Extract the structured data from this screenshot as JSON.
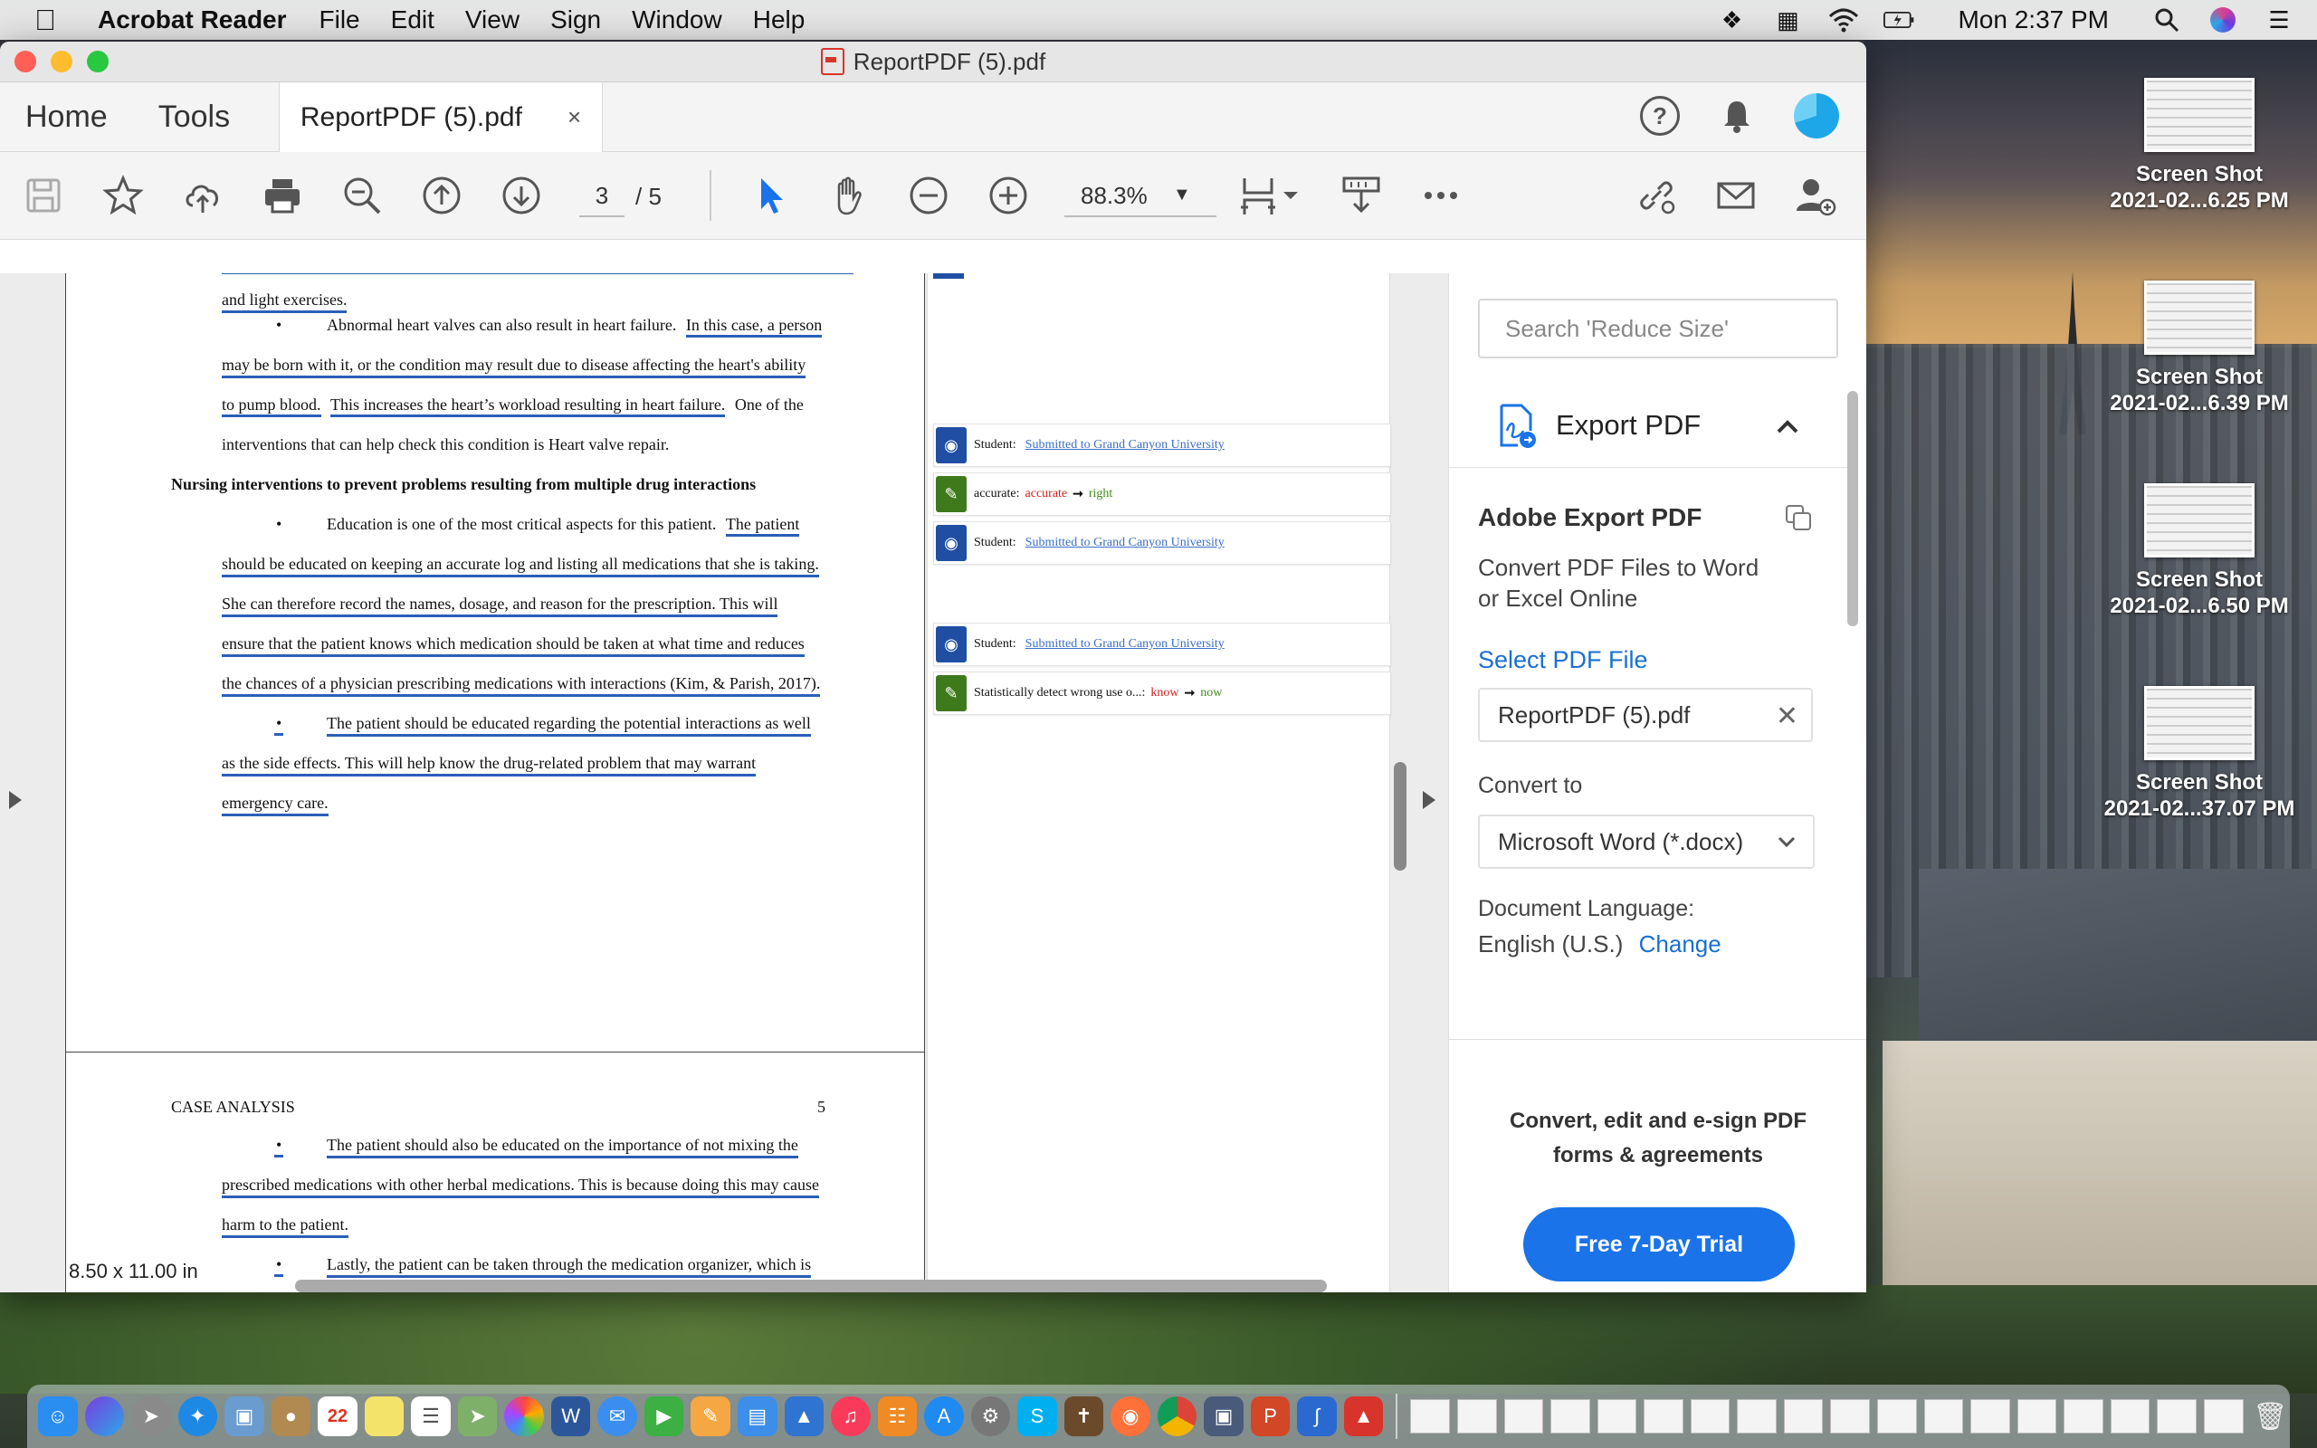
{
  "menubar": {
    "app_name": "Acrobat Reader",
    "items": [
      "File",
      "Edit",
      "View",
      "Sign",
      "Window",
      "Help"
    ],
    "clock": "Mon 2:37 PM"
  },
  "window": {
    "title": "ReportPDF (5).pdf"
  },
  "tabs": {
    "home": "Home",
    "tools": "Tools",
    "document": "ReportPDF (5).pdf",
    "close": "×"
  },
  "toolbar": {
    "current_page": "3",
    "total_pages": "/ 5",
    "zoom": "88.3%"
  },
  "document": {
    "page1": {
      "lines": [
        "and light exercises.",
        "Abnormal heart valves can also result in heart failure.",
        "In this case, a person",
        "may be born with it, or the condition may result due to disease affecting the heart's ability",
        "to pump blood.",
        "This increases the heart’s workload resulting in heart failure.",
        "One of the",
        "interventions that can help check this condition is Heart valve repair.",
        "Nursing interventions to prevent problems resulting from multiple drug interactions",
        "Education is one of the most critical aspects for this patient.",
        "The patient",
        "should be educated on keeping an accurate log and listing all medications that she is taking.",
        "She can therefore record the names, dosage, and reason for the prescription. This will",
        "ensure that the patient knows which medication should be taken at what time and reduces",
        "the chances of a physician prescribing medications with interactions (Kim, & Parish, 2017).",
        "The patient should be educated regarding the potential interactions as well",
        "as the side effects. This will help know the drug-related problem that may warrant",
        "emergency care."
      ],
      "bullet": "•"
    },
    "page2": {
      "header": "CASE ANALYSIS",
      "page_number": "5",
      "lines": [
        "The patient should also be educated on the importance of not mixing the",
        "prescribed medications with other herbal medications. This is because doing this may cause",
        "harm to the patient.",
        "Lastly, the patient can be taken through the medication organizer, which is"
      ]
    },
    "page_size": "8.50 x 11.00 in"
  },
  "comments": [
    {
      "type": "source",
      "label": "Student:",
      "link": "Submitted to Grand Canyon University"
    },
    {
      "type": "correction",
      "label": "accurate:",
      "wrong": "accurate",
      "right": "right"
    },
    {
      "type": "source",
      "label": "Student:",
      "link": "Submitted to Grand Canyon University"
    },
    {
      "type": "source",
      "label": "Student:",
      "link": "Submitted to Grand Canyon University"
    },
    {
      "type": "correction",
      "label": "Statistically detect wrong use o...:",
      "wrong": "know",
      "right": "now"
    }
  ],
  "right_panel": {
    "search_placeholder": "Search 'Reduce Size'",
    "export_title": "Export PDF",
    "ae_title": "Adobe Export PDF",
    "ae_desc_1": "Convert PDF Files to Word",
    "ae_desc_2": "or Excel Online",
    "select_file": "Select PDF File",
    "file_name": "ReportPDF (5).pdf",
    "convert_to": "Convert to",
    "format": "Microsoft Word (*.docx)",
    "lang_label": "Document Language:",
    "lang_value": "English (U.S.)",
    "change": "Change",
    "promo_1": "Convert, edit and e-sign PDF",
    "promo_2": "forms & agreements",
    "trial": "Free 7-Day Trial"
  },
  "desktop": [
    {
      "line1": "Screen Shot",
      "line2": "2021-02...6.25 PM"
    },
    {
      "line1": "Screen Shot",
      "line2": "2021-02...6.39 PM"
    },
    {
      "line1": "Screen Shot",
      "line2": "2021-02...6.50 PM"
    },
    {
      "line1": "Screen Shot",
      "line2": "2021-02...37.07 PM"
    }
  ],
  "dock": {
    "calendar_day": "22"
  },
  "colors": {
    "accent_blue": "#1a73e8",
    "underline_blue": "#2b5fb8",
    "correction_red": "#d0201c",
    "correction_green": "#3e8a1c"
  }
}
